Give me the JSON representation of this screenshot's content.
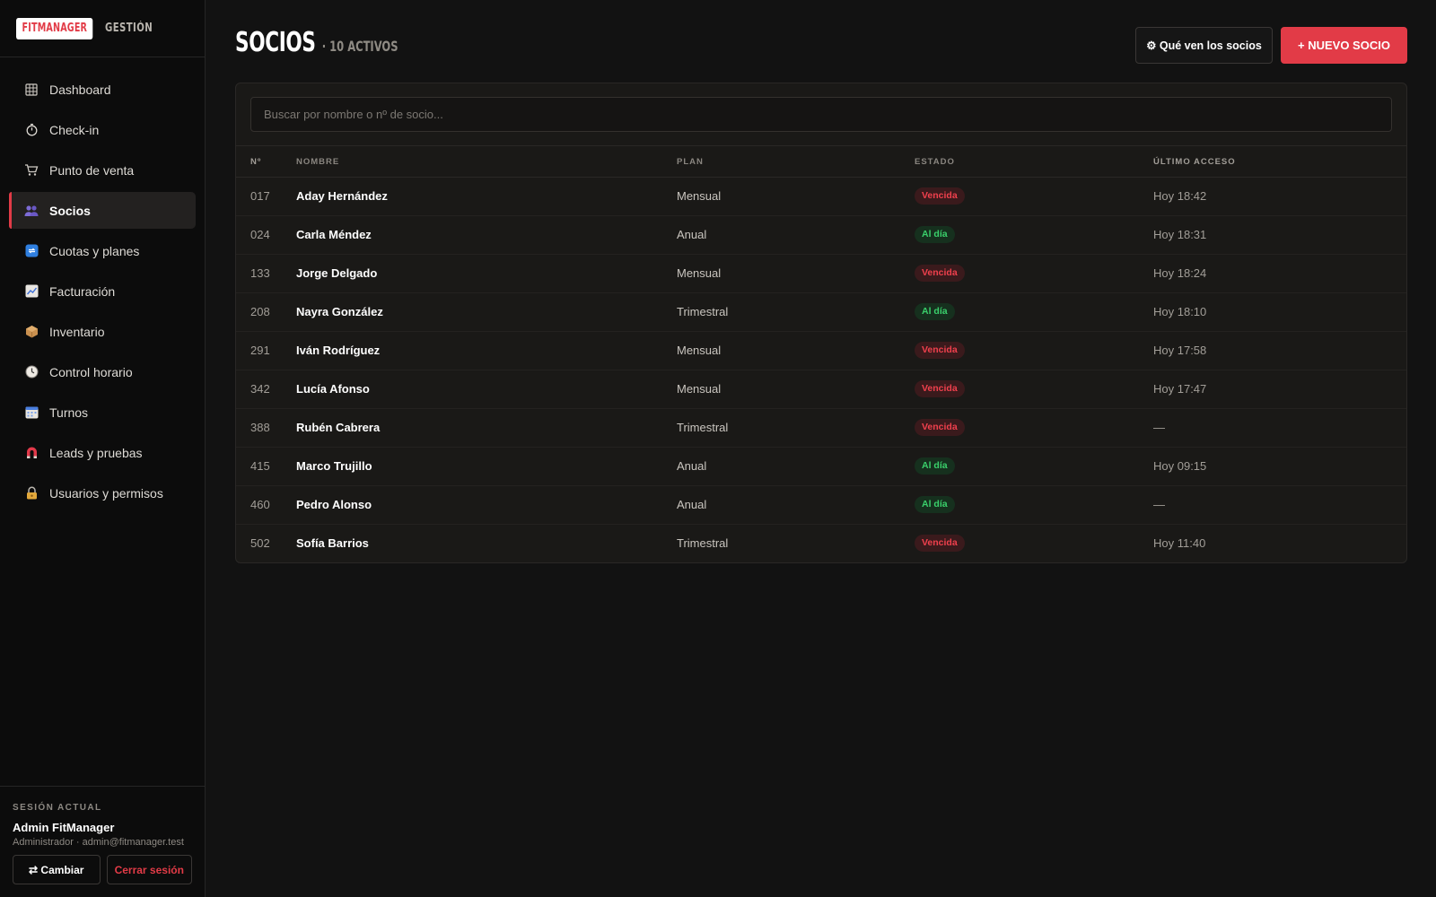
{
  "brand": {
    "badge": "FITMANAGER",
    "sub": "GESTIÓN"
  },
  "sidebar": {
    "items": [
      {
        "label": "Dashboard",
        "icon": "dashboard-icon",
        "active": false
      },
      {
        "label": "Check-in",
        "icon": "stopwatch-icon",
        "active": false
      },
      {
        "label": "Punto de venta",
        "icon": "cart-icon",
        "active": false
      },
      {
        "label": "Socios",
        "icon": "people-icon",
        "active": true
      },
      {
        "label": "Cuotas y planes",
        "icon": "repeat-icon",
        "active": false
      },
      {
        "label": "Facturación",
        "icon": "chart-icon",
        "active": false
      },
      {
        "label": "Inventario",
        "icon": "box-icon",
        "active": false
      },
      {
        "label": "Control horario",
        "icon": "clock-icon",
        "active": false
      },
      {
        "label": "Turnos",
        "icon": "calendar-icon",
        "active": false
      },
      {
        "label": "Leads y pruebas",
        "icon": "magnet-icon",
        "active": false
      },
      {
        "label": "Usuarios y permisos",
        "icon": "lock-icon",
        "active": false
      }
    ]
  },
  "session": {
    "caption": "SESIÓN ACTUAL",
    "name": "Admin FitManager",
    "detail": "Administrador · admin@fitmanager.test",
    "change_label": "⇄ Cambiar",
    "logout_label": "Cerrar sesión"
  },
  "header": {
    "title": "SOCIOS",
    "subtitle": "· 10 ACTIVOS",
    "outline_button": "⚙ Qué ven los socios",
    "primary_button": "+ NUEVO SOCIO"
  },
  "search": {
    "placeholder": "Buscar por nombre o nº de socio..."
  },
  "table": {
    "headers": {
      "num": "Nº",
      "name": "NOMBRE",
      "plan": "PLAN",
      "estado": "ESTADO",
      "acceso": "ÚLTIMO ACCESO"
    },
    "rows": [
      {
        "num": "017",
        "name": "Aday Hernández",
        "plan": "Mensual",
        "estado": "Vencida",
        "status": "red",
        "acceso": "Hoy 18:42"
      },
      {
        "num": "024",
        "name": "Carla Méndez",
        "plan": "Anual",
        "estado": "Al día",
        "status": "green",
        "acceso": "Hoy 18:31"
      },
      {
        "num": "133",
        "name": "Jorge Delgado",
        "plan": "Mensual",
        "estado": "Vencida",
        "status": "red",
        "acceso": "Hoy 18:24"
      },
      {
        "num": "208",
        "name": "Nayra González",
        "plan": "Trimestral",
        "estado": "Al día",
        "status": "green",
        "acceso": "Hoy 18:10"
      },
      {
        "num": "291",
        "name": "Iván Rodríguez",
        "plan": "Mensual",
        "estado": "Vencida",
        "status": "red",
        "acceso": "Hoy 17:58"
      },
      {
        "num": "342",
        "name": "Lucía Afonso",
        "plan": "Mensual",
        "estado": "Vencida",
        "status": "red",
        "acceso": "Hoy 17:47"
      },
      {
        "num": "388",
        "name": "Rubén Cabrera",
        "plan": "Trimestral",
        "estado": "Vencida",
        "status": "red",
        "acceso": "—"
      },
      {
        "num": "415",
        "name": "Marco Trujillo",
        "plan": "Anual",
        "estado": "Al día",
        "status": "green",
        "acceso": "Hoy 09:15"
      },
      {
        "num": "460",
        "name": "Pedro Alonso",
        "plan": "Anual",
        "estado": "Al día",
        "status": "green",
        "acceso": "—"
      },
      {
        "num": "502",
        "name": "Sofía Barrios",
        "plan": "Trimestral",
        "estado": "Vencida",
        "status": "red",
        "acceso": "Hoy 11:40"
      }
    ]
  },
  "colors": {
    "accent": "#e23b47",
    "ok": "#3ad06b",
    "bg": "#121212",
    "sidebar_bg": "#0c0c0c"
  }
}
